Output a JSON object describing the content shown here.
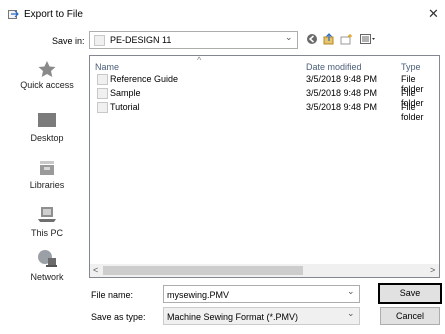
{
  "window": {
    "title": "Export to File",
    "close_glyph": "✕"
  },
  "save_in": {
    "label": "Save in:",
    "value": "PE-DESIGN 11"
  },
  "toolbar_icons": [
    "back-icon",
    "up-folder-icon",
    "new-folder-icon",
    "view-menu-icon"
  ],
  "places": [
    {
      "label": "Quick access",
      "icon": "star-icon"
    },
    {
      "label": "Desktop",
      "icon": "desktop-icon"
    },
    {
      "label": "Libraries",
      "icon": "libraries-icon"
    },
    {
      "label": "This PC",
      "icon": "computer-icon"
    },
    {
      "label": "Network",
      "icon": "network-icon"
    }
  ],
  "columns": {
    "name": "Name",
    "date": "Date modified",
    "type": "Type"
  },
  "files": [
    {
      "name": "Reference Guide",
      "date": "3/5/2018 9:48 PM",
      "type": "File folder"
    },
    {
      "name": "Sample",
      "date": "3/5/2018 9:48 PM",
      "type": "File folder"
    },
    {
      "name": "Tutorial",
      "date": "3/5/2018 9:48 PM",
      "type": "File folder"
    }
  ],
  "file_name": {
    "label": "File name:",
    "value": "mysewing.PMV"
  },
  "save_as_type": {
    "label": "Save as type:",
    "value": "Machine Sewing Format (*.PMV)"
  },
  "buttons": {
    "save": "Save",
    "cancel": "Cancel"
  },
  "scroll_arrows": {
    "left": "<",
    "right": ">"
  },
  "sort_glyph": "^",
  "chevron": "⌄"
}
